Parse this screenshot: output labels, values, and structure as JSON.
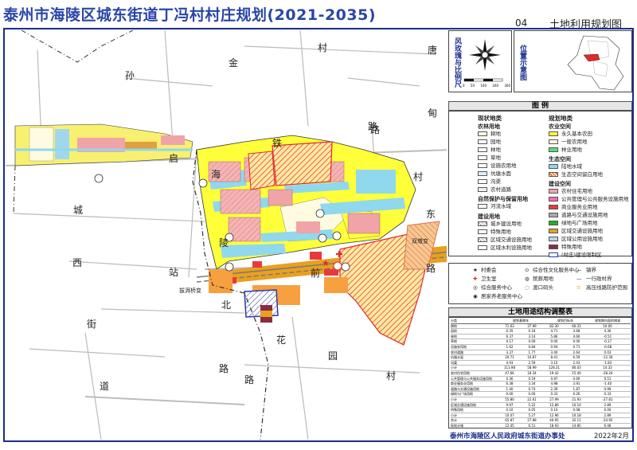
{
  "header": {
    "title": "泰州市海陵区城东街道丁冯村村庄规划(2021-2035)",
    "page_number": "04",
    "page_title": "土地利用规划图"
  },
  "map_labels": {
    "sun": "孙",
    "jin": "金",
    "cun1": "村",
    "tang": "唐",
    "dian": "甸",
    "lu1": "路",
    "cun2": "村",
    "cheng": "城",
    "xi": "西",
    "jie": "街",
    "dao": "道",
    "hua": "花",
    "yuan": "园",
    "cun3": "村",
    "lu2": "路",
    "qi": "启",
    "tie": "铁",
    "hai": "海",
    "ling": "陵",
    "zhan": "站",
    "bei": "北",
    "lu3": "路",
    "qian": "前",
    "dong": "东",
    "road_sign": "路",
    "lu4": "路",
    "interchange1": "拔湃桥变",
    "interchange2": "双墩变"
  },
  "windrose": {
    "label": "风玫瑰与比例尺",
    "scale_ticks": [
      "0",
      "50",
      "100",
      "200",
      "300"
    ]
  },
  "location": {
    "label": "位置示意图"
  },
  "legend": {
    "title": "图 例",
    "current_heading": "现状地类",
    "planned_heading": "规划地类",
    "current": {
      "farm_heading": "农林用地",
      "farm_items": [
        "耕地",
        "园地",
        "林地",
        "草地",
        "设施农用地",
        "坑塘水面",
        "沟渠",
        "农村道路"
      ],
      "nature_heading": "自然保护与保留用地",
      "nature_items": [
        "河流水域"
      ],
      "build_heading": "建设用地",
      "build_items": [
        "城乡建设用地",
        "特殊用地",
        "区域交通设施用地",
        "区域水利设施用地"
      ]
    },
    "planned": {
      "farm_heading": "农业空间",
      "farm_items": [
        "永久基本农田",
        "一般农用地",
        "林业用地"
      ],
      "eco_heading": "生态空间",
      "eco_items": [
        "陆地水域",
        "生态空间留白用地"
      ],
      "build_heading": "建设空间",
      "build_items": [
        "农村住宅用地",
        "公共管理与公共服务设施用地",
        "商业服务业用地",
        "道路与交通设施用地",
        "绿地与广场用地",
        "区域交通设施用地",
        "区域公用设施用地",
        "特殊用地"
      ],
      "village_boundary": "(村庄)建设限制区"
    },
    "symbols": [
      {
        "icon": "★",
        "label": "村委会"
      },
      {
        "icon": "✚",
        "label": "卫生室"
      },
      {
        "icon": "◎",
        "label": "综合服务中心"
      },
      {
        "icon": "◉",
        "label": "居家养老服务中心"
      },
      {
        "icon": "⊙",
        "label": "综合性文化服务中心"
      },
      {
        "icon": "◍",
        "label": "殡葬用地"
      },
      {
        "icon": "◌",
        "label": "渡口码头"
      },
      {
        "icon": "—",
        "label": "镇界"
      },
      {
        "icon": "—",
        "label": "一行政村界"
      },
      {
        "icon": "≡",
        "label": "高压线路防护范围"
      }
    ]
  },
  "table": {
    "title": "土地用途结构调整表",
    "headers": [
      "分类",
      "规划基期年",
      "规划目标年",
      "规划期内面积增减"
    ],
    "rows": [
      [
        "耕地",
        "71.63",
        "37.99",
        "82.30",
        "60.31",
        "10.00"
      ],
      [
        "园地",
        "0.35",
        "0.18",
        "4.71",
        "3.68",
        "4.36"
      ],
      [
        "林地",
        "6.37",
        "3.14",
        "5.86",
        "4.60",
        "-0.51"
      ],
      [
        "草地",
        "0.17",
        "0.09",
        "0.00",
        "0.00",
        "-0.17"
      ],
      [
        "设施农用地",
        "1.62",
        "0.84",
        "0.94",
        "0.71",
        "-0.68"
      ],
      [
        "农村道路",
        "3.37",
        "1.77",
        "3.40",
        "2.64",
        "0.03"
      ],
      [
        "坑塘水面",
        "20.71",
        "10.87",
        "8.41",
        "6.59",
        "-12.30"
      ],
      [
        "沟渠",
        "4.93",
        "2.59",
        "3.10",
        "2.43",
        "-1.83"
      ],
      [
        "小计",
        "113.98",
        "58.99",
        "128.31",
        "80.03",
        "14.33"
      ],
      [
        "农村住宅用地",
        "47.66",
        "18.34",
        "19.42",
        "15.40",
        "-28.24"
      ],
      [
        "公共管理与公共服务设施用地",
        "0.36",
        "0.19",
        "0.87",
        "0.69",
        "0.51"
      ],
      [
        "商业服务业用地",
        "6.38",
        "3.34",
        "4.98",
        "3.91",
        "-1.40"
      ],
      [
        "道路与交通设施用地",
        "1.40",
        "0.74",
        "2.39",
        "1.87",
        "0.99"
      ],
      [
        "绿地与广场用地",
        "0.00",
        "0.00",
        "0.33",
        "0.26",
        "0.33"
      ],
      [
        "小计",
        "55.80",
        "22.61",
        "27.99",
        "21.93",
        "-27.81"
      ],
      [
        "区域交通设施用地",
        "9.97",
        "5.22",
        "12.86",
        "10.10",
        "2.89"
      ],
      [
        "特殊用地",
        "0.10",
        "0.05",
        "0.10",
        "0.08",
        "0.00"
      ],
      [
        "小计",
        "10.07",
        "5.27",
        "12.96",
        "10.18",
        "2.89"
      ],
      [
        "合计",
        "65.87",
        "27.88",
        "40.95",
        "32.11",
        "-24.92"
      ],
      [
        "陆地水域",
        "12.45",
        "6.51",
        "18.93",
        "14.85",
        "6.48"
      ],
      [
        "合计",
        "191.30",
        "100",
        "191.30",
        "100",
        "0.00"
      ]
    ]
  },
  "footer": {
    "authority": "泰州市海陵区人民政府城东街道办事处",
    "date": "2022年2月"
  },
  "colors": {
    "frame": "#1a2c8a",
    "farmland_permanent": "#ffff00",
    "farmland_general": "#fffbe0",
    "forest": "#5fd77a",
    "water": "#8fd8ee",
    "residential": "#f0a4a8",
    "public_service": "#f06fb0",
    "commercial": "#e83a3a",
    "road": "#a9a9a9",
    "green": "#1fb41f",
    "regional_transport": "#e8a020",
    "special": "#8a2c40",
    "eco_reserve": "#ffd0a0"
  }
}
